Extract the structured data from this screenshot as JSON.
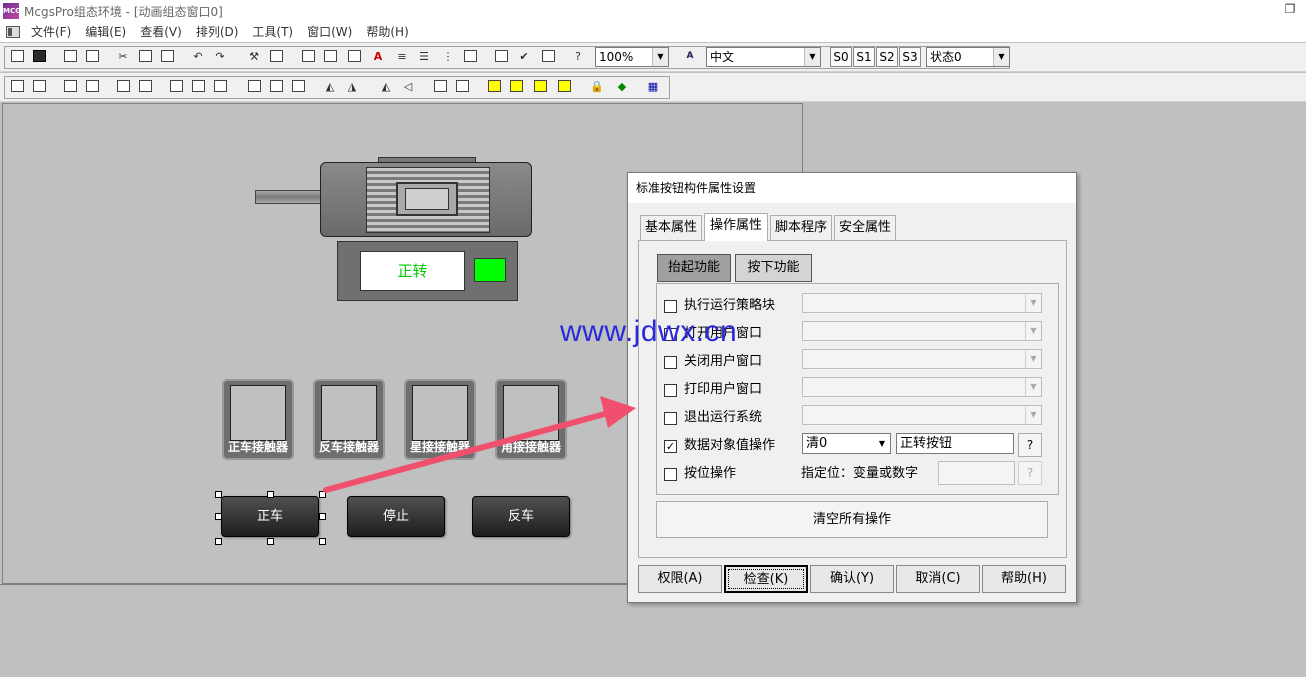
{
  "window": {
    "title": "McgsPro组态环境 - [动画组态窗口0]",
    "logo_text": "MCGS",
    "restore_glyph": "❐"
  },
  "menu": {
    "items": [
      "文件(F)",
      "编辑(E)",
      "查看(V)",
      "排列(D)",
      "工具(T)",
      "窗口(W)",
      "帮助(H)"
    ]
  },
  "toolbar": {
    "zoom": "100%",
    "language": "中文",
    "states": [
      "S0",
      "S1",
      "S2",
      "S3"
    ],
    "state_select": "状态0"
  },
  "canvas": {
    "status_text": "正转",
    "contactors": [
      "正车接触器",
      "反车接触器",
      "星接接触器",
      "角接接触器"
    ],
    "buttons": [
      "正车",
      "停止",
      "反车"
    ]
  },
  "watermark": "www.jdwx.cn",
  "dialog": {
    "title": "标准按钮构件属性设置",
    "tabs": [
      "基本属性",
      "操作属性",
      "脚本程序",
      "安全属性"
    ],
    "subtabs": [
      "抬起功能",
      "按下功能"
    ],
    "rows": [
      {
        "label": "执行运行策略块",
        "checked": false
      },
      {
        "label": "打开用户窗口",
        "checked": false
      },
      {
        "label": "关闭用户窗口",
        "checked": false
      },
      {
        "label": "打印用户窗口",
        "checked": false
      },
      {
        "label": "退出运行系统",
        "checked": false
      },
      {
        "label": "数据对象值操作",
        "checked": true
      },
      {
        "label": "按位操作",
        "checked": false
      }
    ],
    "data_op": {
      "op": "清0",
      "target": "正转按钮",
      "help": "?"
    },
    "bit_op": {
      "label": "指定位：变量或数字",
      "help": "?"
    },
    "check_glyph": "✓",
    "dd_glyph": "▼",
    "clear_button": "清空所有操作",
    "bottom_buttons": [
      "权限(A)",
      "检查(K)",
      "确认(Y)",
      "取消(C)",
      "帮助(H)"
    ]
  }
}
